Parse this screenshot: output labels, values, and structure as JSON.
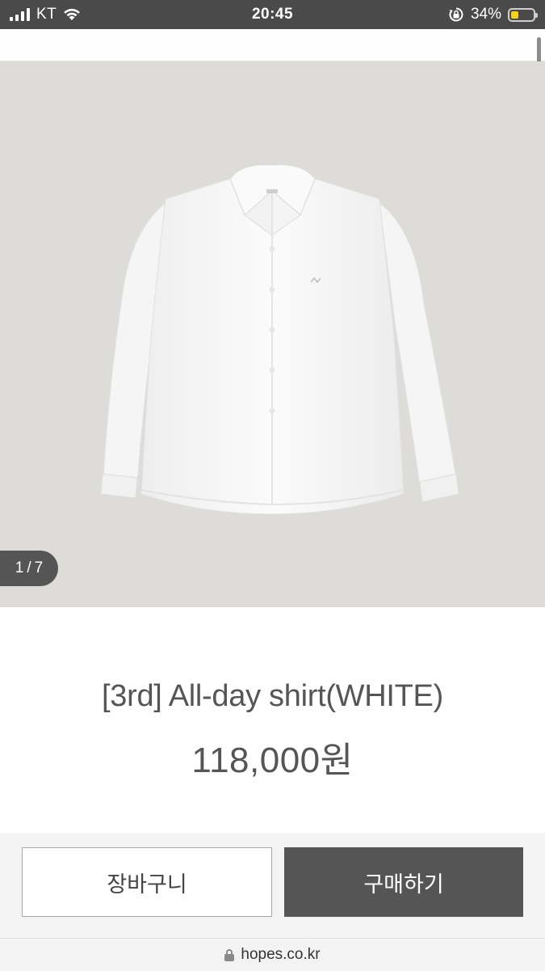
{
  "status_bar": {
    "carrier": "KT",
    "time": "20:45",
    "battery_percent": "34%",
    "battery_level": 0.34,
    "icons": [
      "signal-icon",
      "wifi-icon",
      "orientation-lock-icon",
      "battery-icon"
    ]
  },
  "gallery": {
    "current_page": "1",
    "separator": "/",
    "total_pages": "7",
    "background_color": "#dedcd8"
  },
  "product": {
    "title": "[3rd] All-day shirt(WHITE)",
    "price": "118,000원"
  },
  "actions": {
    "cart_label": "장바구니",
    "buy_label": "구매하기"
  },
  "browser": {
    "url": "hopes.co.kr"
  },
  "colors": {
    "status_bar": "#4a4a4a",
    "text": "#555555",
    "buy_button": "#555555",
    "battery": "#f7d21b"
  }
}
